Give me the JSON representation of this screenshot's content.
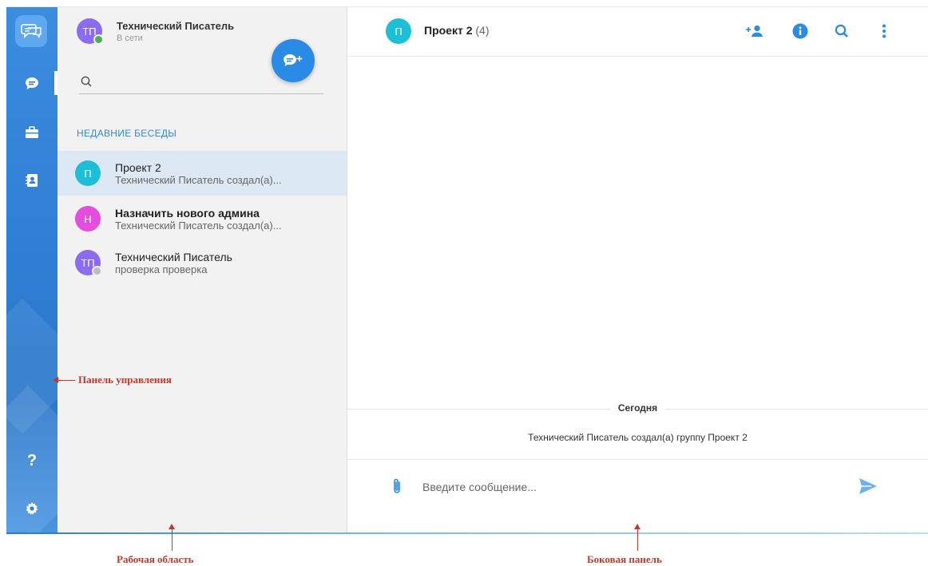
{
  "colors": {
    "accent": "#2a8be6",
    "rail": "#2f7fd6",
    "panel_bg": "#f2f2f2",
    "selected_bg": "#dce9f5",
    "online": "#4caf50",
    "offline": "#bdbdbd",
    "annotation": "#c0392b"
  },
  "rail": {
    "icons": [
      "chat-logo-icon",
      "chats-icon",
      "briefcase-icon",
      "contacts-icon",
      "help-icon",
      "settings-icon"
    ],
    "help_label": "?"
  },
  "user": {
    "initials": "ТП",
    "name": "Технический Писатель",
    "status": "В сети",
    "avatar_color": "#8b6cf0"
  },
  "search": {
    "placeholder": ""
  },
  "recent_label": "НЕДАВНИЕ БЕСЕДЫ",
  "conversations": [
    {
      "initials": "П",
      "title": "Проект 2",
      "preview": "Технический Писатель создал(а)...",
      "color": "#1cbfd6"
    },
    {
      "initials": "Н",
      "title": "Назначить нового админа",
      "preview": "Технический Писатель создал(а)...",
      "color": "#e44dde"
    },
    {
      "initials": "ТП",
      "title": "Технический Писатель",
      "preview": "проверка проверка",
      "color": "#8b6cf0"
    }
  ],
  "chat": {
    "initials": "П",
    "title": "Проект 2",
    "count": "(4)",
    "day_label": "Сегодня",
    "system_message": "Технический Писатель создал(а) группу Проект 2",
    "input_placeholder": "Введите сообщение..."
  },
  "annotations": {
    "control_panel": "Панель управления",
    "work_area": "Рабочая область",
    "side_panel": "Боковая панель"
  }
}
